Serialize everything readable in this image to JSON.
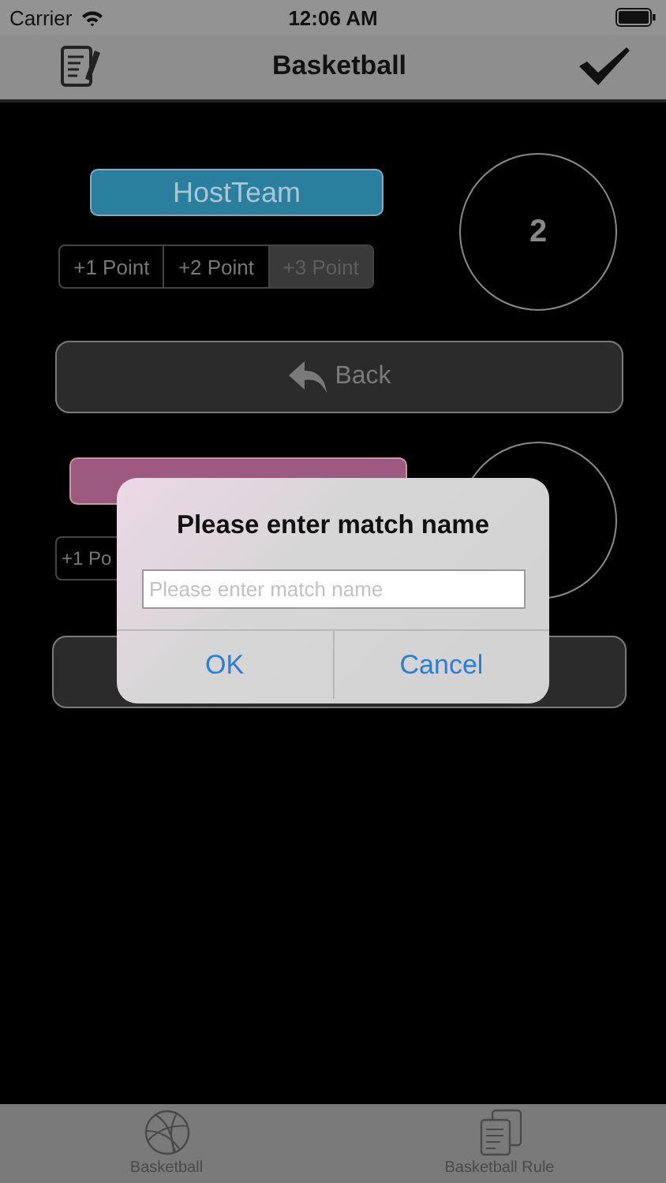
{
  "status_bar": {
    "carrier": "Carrier",
    "time": "12:06 AM"
  },
  "nav_bar": {
    "title": "Basketball"
  },
  "sections": [
    {
      "kind": "team",
      "label": "HostTeam",
      "color": "#2b7f9e",
      "score": "2",
      "points": [
        {
          "label": "+1 Point",
          "selected": false
        },
        {
          "label": "+2 Point",
          "selected": false
        },
        {
          "label": "+3 Point",
          "selected": true
        }
      ]
    },
    {
      "kind": "back_button",
      "label": "Back"
    },
    {
      "kind": "team",
      "color": "#9c5a80",
      "points": [
        {
          "label": "+1 Po",
          "selected": false
        }
      ]
    },
    {
      "kind": "plain_button"
    }
  ],
  "dialog": {
    "title": "Please enter match name",
    "placeholder": "Please enter match name",
    "buttons": [
      "OK",
      "Cancel"
    ]
  },
  "tab_bar": {
    "items": [
      {
        "kind": "ball",
        "label": "Basketball"
      },
      {
        "kind": "pages",
        "label": "Basketball Rule"
      }
    ]
  }
}
